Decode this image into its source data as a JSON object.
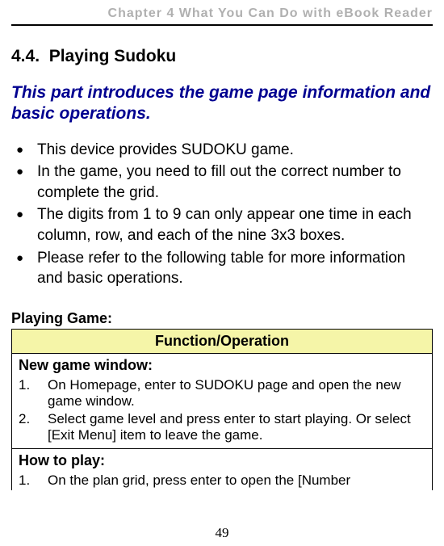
{
  "chapter_header": "Chapter 4 What You Can Do with eBook Reader",
  "section_number": "4.4.",
  "section_title": "Playing Sudoku",
  "intro": "This part introduces the game page information and basic operations.",
  "bullets": [
    "This device provides SUDOKU game.",
    "In the game, you need to fill out the correct number to complete the grid.",
    "The digits from 1 to 9 can only appear one time in each column, row, and each of the nine 3x3 boxes.",
    "Please refer to the following table for more information and basic operations."
  ],
  "table_caption": "Playing Game:",
  "table_header": "Function/Operation",
  "rows": [
    {
      "title": "New game window:",
      "steps": [
        {
          "n": "1.",
          "t": "On Homepage, enter to SUDOKU page and open the new game window."
        },
        {
          "n": "2.",
          "t": "Select game level and press enter to start playing. Or select [Exit Menu] item to leave the game."
        }
      ]
    },
    {
      "title": "How to play:",
      "steps": [
        {
          "n": "1.",
          "t": "On the plan grid, press enter to open the [Number"
        }
      ]
    }
  ],
  "page_number": "49"
}
